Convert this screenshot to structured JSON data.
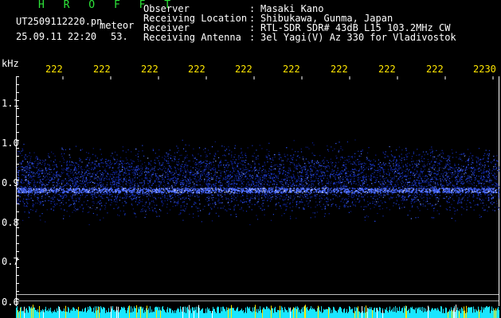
{
  "header": {
    "title": "H R O F F T",
    "file_name": "UT2509112220.pn",
    "type_label": "meteor",
    "date_time": "25.09.11 22:20",
    "count": "53."
  },
  "meta": {
    "observer_label": "Observer",
    "observer_value": "Masaki Kano",
    "location_label": "Receiving Location",
    "location_value": "Shibukawa, Gunma, Japan",
    "receiver_label": "Receiver",
    "receiver_value": "RTL-SDR SDR# 43dB L15 103.2MHz CW",
    "antenna_label": "Receiving Antenna",
    "antenna_value": "3el Yagi(V) Az 330 for Vladivostok",
    "colon": ":"
  },
  "axes": {
    "unit": "kHz",
    "x_ticks": [
      "222",
      "222",
      "222",
      "222",
      "222",
      "222",
      "222",
      "222",
      "222",
      "2230"
    ],
    "y_ticks": [
      "1.1",
      "1.0",
      "0.9",
      "0.8",
      "0.7",
      "0.6"
    ]
  },
  "colors": {
    "background": "#000000",
    "title": "#2ee63a",
    "ticks_x": "#ffe600",
    "signal": "#3b5bff",
    "noise_strip": "#19e6ff",
    "meteor_spike": "#ffe600"
  }
}
